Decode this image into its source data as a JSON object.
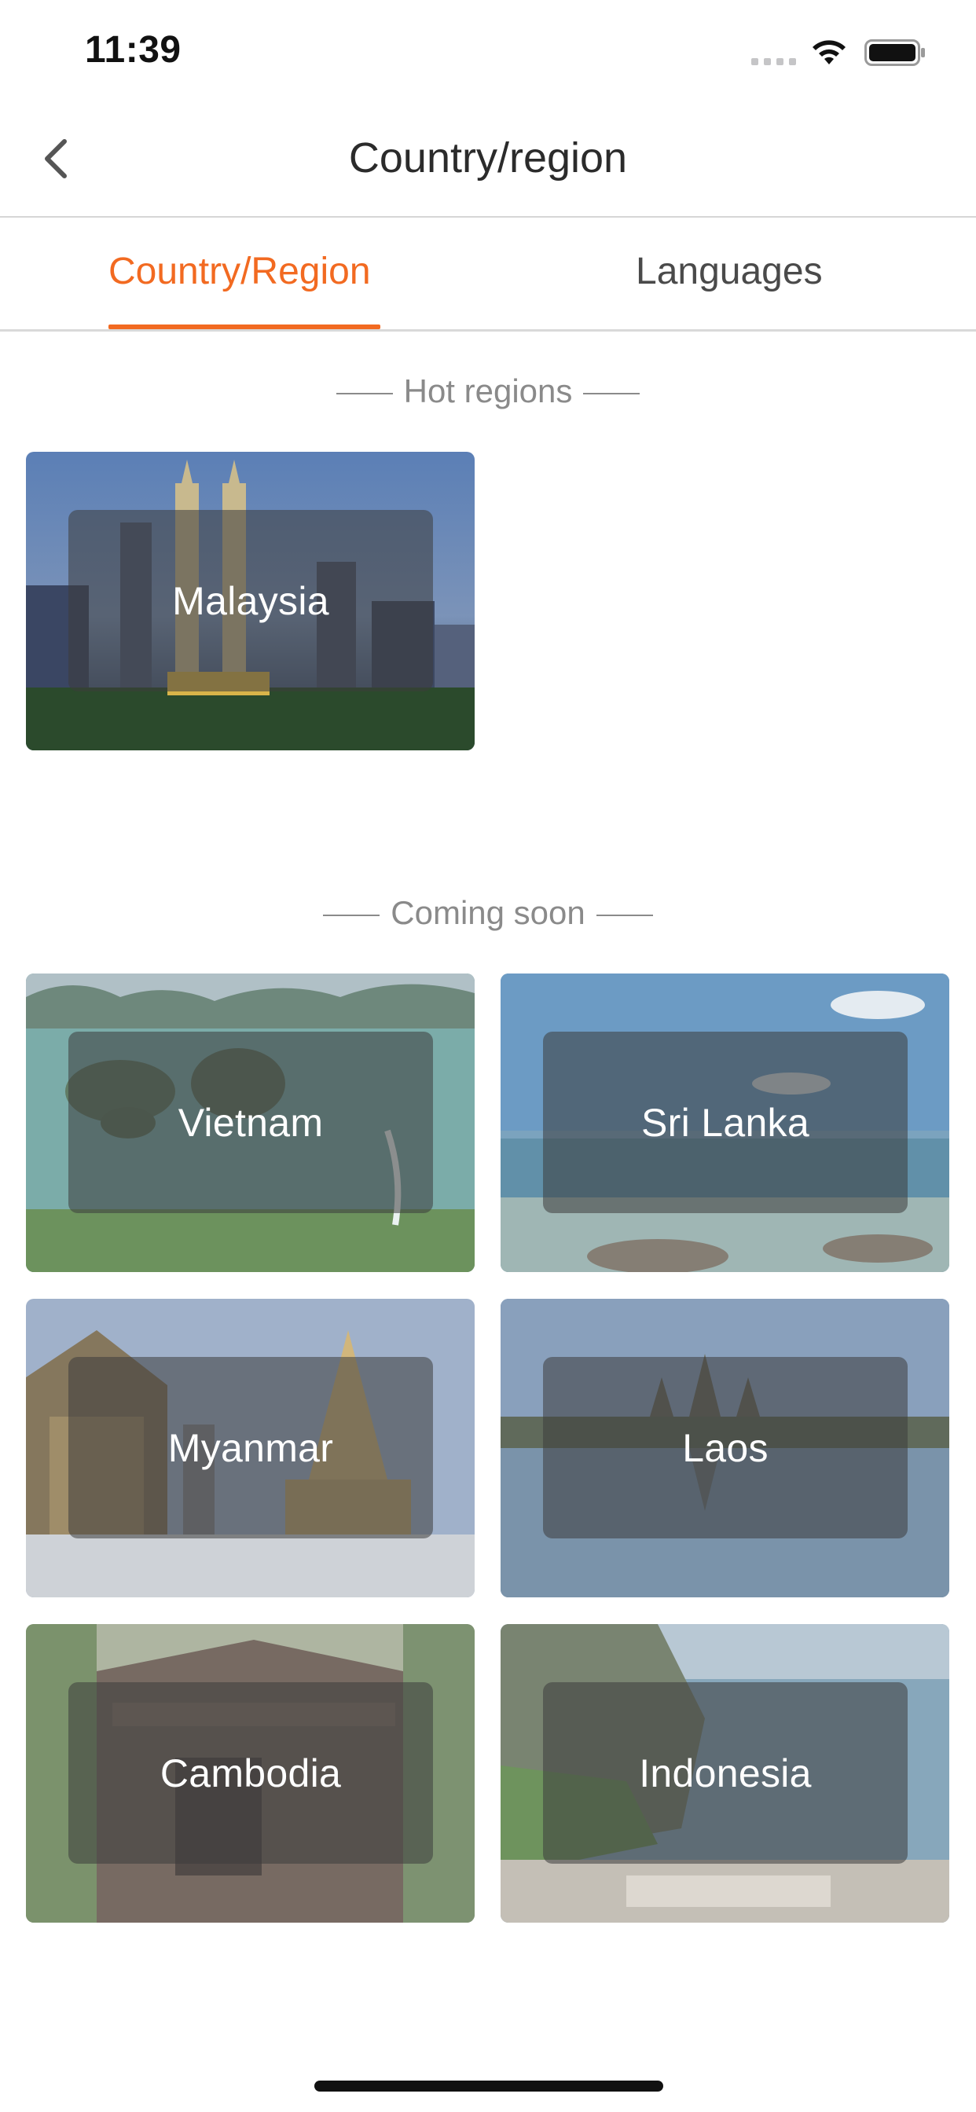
{
  "status_bar": {
    "time": "11:39",
    "signal_icon": "cellular-signal-icon",
    "wifi_icon": "wifi-icon",
    "battery_icon": "battery-icon"
  },
  "nav": {
    "back_icon": "chevron-left-icon",
    "title": "Country/region"
  },
  "tabs": [
    {
      "label": "Country/Region",
      "active": true
    },
    {
      "label": "Languages",
      "active": false
    }
  ],
  "hot_regions": {
    "header": "Hot regions",
    "items": [
      {
        "name": "Malaysia"
      }
    ]
  },
  "coming_soon": {
    "header": "Coming soon",
    "items": [
      {
        "name": "Vietnam"
      },
      {
        "name": "Sri Lanka"
      },
      {
        "name": "Myanmar"
      },
      {
        "name": "Laos"
      },
      {
        "name": "Cambodia"
      },
      {
        "name": "Indonesia"
      }
    ]
  },
  "colors": {
    "accent": "#f26a21",
    "section_text": "#8a8a8a",
    "label_overlay": "rgba(60,60,60,0.55)"
  }
}
